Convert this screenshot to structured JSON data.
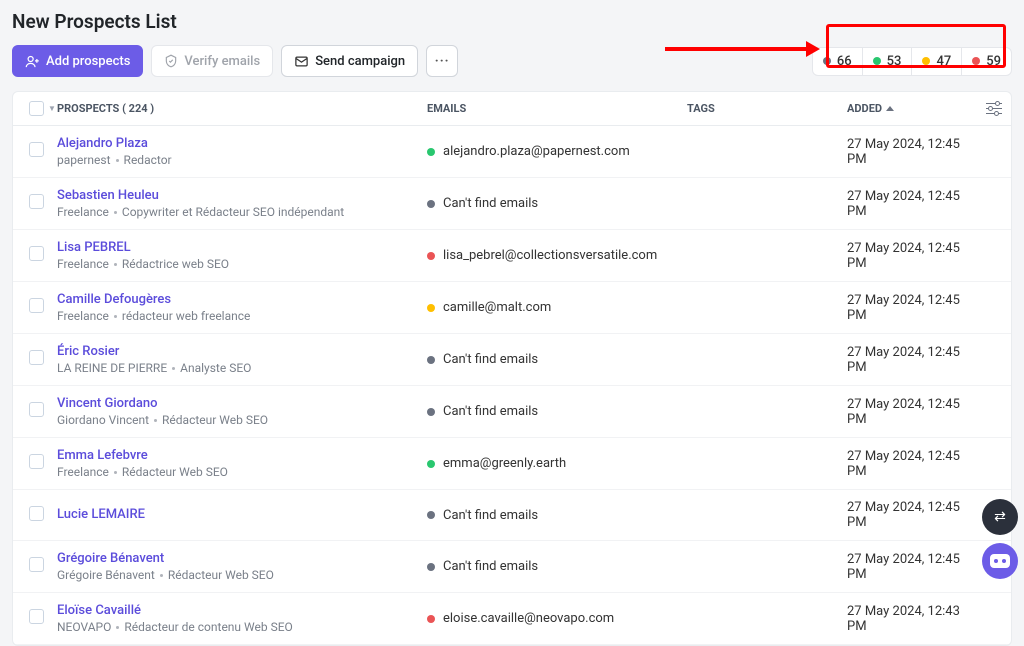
{
  "page": {
    "title": "New Prospects List"
  },
  "toolbar": {
    "add_prospects_label": "Add prospects",
    "verify_emails_label": "Verify emails",
    "send_campaign_label": "Send campaign"
  },
  "status_counts": {
    "grey": 66,
    "green": 53,
    "amber": 47,
    "red": 59
  },
  "table": {
    "header": {
      "prospects_label": "PROSPECTS",
      "prospects_count": "( 224 )",
      "emails_label": "EMAILS",
      "tags_label": "TAGS",
      "added_label": "ADDED"
    },
    "rows": [
      {
        "name": "Alejandro Plaza",
        "company": "papernest",
        "role": "Redactor",
        "email": "alejandro.plaza@papernest.com",
        "status": "green",
        "added": "27 May 2024, 12:45 PM"
      },
      {
        "name": "Sebastien Heuleu",
        "company": "Freelance",
        "role": "Copywriter et Rédacteur SEO indépendant",
        "email": "Can't find emails",
        "status": "grey",
        "added": "27 May 2024, 12:45 PM"
      },
      {
        "name": "Lisa PEBREL",
        "company": "Freelance",
        "role": "Rédactrice web SEO",
        "email": "lisa_pebrel@collectionsversatile.com",
        "status": "red",
        "added": "27 May 2024, 12:45 PM"
      },
      {
        "name": "Camille Defougères",
        "company": "Freelance",
        "role": "rédacteur web freelance",
        "email": "camille@malt.com",
        "status": "amber",
        "added": "27 May 2024, 12:45 PM"
      },
      {
        "name": "Éric Rosier",
        "company": "LA REINE DE PIERRE",
        "role": "Analyste SEO",
        "email": "Can't find emails",
        "status": "grey",
        "added": "27 May 2024, 12:45 PM"
      },
      {
        "name": "Vincent Giordano",
        "company": "Giordano Vincent",
        "role": "Rédacteur Web SEO",
        "email": "Can't find emails",
        "status": "grey",
        "added": "27 May 2024, 12:45 PM"
      },
      {
        "name": "Emma Lefebvre",
        "company": "Freelance",
        "role": "Rédacteur Web SEO",
        "email": "emma@greenly.earth",
        "status": "green",
        "added": "27 May 2024, 12:45 PM"
      },
      {
        "name": "Lucie LEMAIRE",
        "company": "",
        "role": "",
        "email": "Can't find emails",
        "status": "grey",
        "added": "27 May 2024, 12:45 PM"
      },
      {
        "name": "Grégoire Bénavent",
        "company": "Grégoire Bénavent",
        "role": "Rédacteur Web SEO",
        "email": "Can't find emails",
        "status": "grey",
        "added": "27 May 2024, 12:45 PM"
      },
      {
        "name": "Eloïse Cavaillé",
        "company": "NEOVAPO",
        "role": "Rédacteur de contenu Web SEO",
        "email": "eloise.cavaille@neovapo.com",
        "status": "red",
        "added": "27 May 2024, 12:43 PM"
      }
    ]
  },
  "colors": {
    "grey": "#6b7280",
    "green": "#29c76f",
    "amber": "#ffbf00",
    "red": "#ea5455",
    "primary": "#6c5ce7"
  }
}
